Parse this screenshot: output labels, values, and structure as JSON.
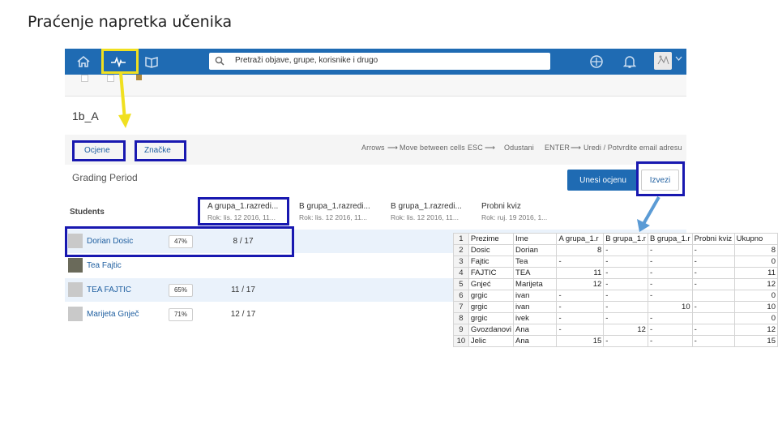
{
  "slide": {
    "title": "Praćenje napretka učenika"
  },
  "navbar": {
    "search_placeholder": "Pretraži objave, grupe, korisnike i drugo",
    "icons": [
      "home-icon",
      "progress-icon",
      "library-icon",
      "backpack-icon",
      "bell-icon",
      "avatar",
      "chevron-down-icon"
    ]
  },
  "group": {
    "name": "1b_A"
  },
  "tabs": {
    "grades": "Ocjene",
    "badges": "Značke"
  },
  "hints": {
    "arrows_key": "Arrows",
    "arrows_action": "Move between cells",
    "esc_key": "ESC",
    "esc_action": "Odustani",
    "enter_key": "ENTER",
    "enter_action": "Uredi / Potvrdite email adresu"
  },
  "grading": {
    "period_label": "Grading Period",
    "enter_grade_button": "Unesi ocjenu",
    "export_button": "Izvezi"
  },
  "table": {
    "students_header": "Students",
    "columns": [
      {
        "title": "A grupa_1.razredi...",
        "due": "Rok: lis. 12 2016, 11..."
      },
      {
        "title": "B grupa_1.razredi...",
        "due": "Rok: lis. 12 2016, 11..."
      },
      {
        "title": "B grupa_1.razredi...",
        "due": "Rok: lis. 12 2016, 11..."
      },
      {
        "title": "Probni kviz",
        "due": "Rok: ruj. 19 2016, 1..."
      }
    ],
    "rows": [
      {
        "name": "Dorian Dosic",
        "percent": "47%",
        "score": "8 / 17"
      },
      {
        "name": "Tea Fajtic",
        "percent": "",
        "score": ""
      },
      {
        "name": "TEA FAJTIC",
        "percent": "65%",
        "score": "11 / 17"
      },
      {
        "name": "Marijeta Gnječ",
        "percent": "71%",
        "score": "12 / 17"
      }
    ]
  },
  "excel": {
    "header": [
      "Prezime",
      "Ime",
      "A grupa_1.r",
      "B grupa_1.r",
      "B grupa_1.r",
      "Probni kviz",
      "Ukupno"
    ],
    "rows": [
      [
        "2",
        "Dosic",
        "Dorian",
        "8",
        "-",
        "-",
        "-",
        "8"
      ],
      [
        "3",
        "Fajtic",
        "Tea",
        "-",
        "-",
        "-",
        "-",
        "0"
      ],
      [
        "4",
        "FAJTIC",
        "TEA",
        "11",
        "-",
        "-",
        "-",
        "11"
      ],
      [
        "5",
        "Gnjeć",
        "Marijeta",
        "12",
        "-",
        "-",
        "-",
        "12"
      ],
      [
        "6",
        "grgic",
        "ivan",
        "-",
        "-",
        "-",
        "",
        "0"
      ],
      [
        "7",
        "grgic",
        "ivan",
        "-",
        "-",
        "10",
        "-",
        "10"
      ],
      [
        "8",
        "grgic",
        "ivek",
        "-",
        "-",
        "-",
        "",
        "0"
      ],
      [
        "9",
        "Gvozdanovi",
        "Ana",
        "-",
        "12",
        "-",
        "-",
        "12"
      ],
      [
        "10",
        "Jelic",
        "Ana",
        "15",
        "-",
        "-",
        "-",
        "15"
      ]
    ],
    "first_row_number": "1"
  },
  "colors": {
    "nav": "#1f6bb3",
    "highlight_blue": "#1818b0",
    "highlight_yellow": "#f0e020",
    "link": "#1f5fa0"
  }
}
